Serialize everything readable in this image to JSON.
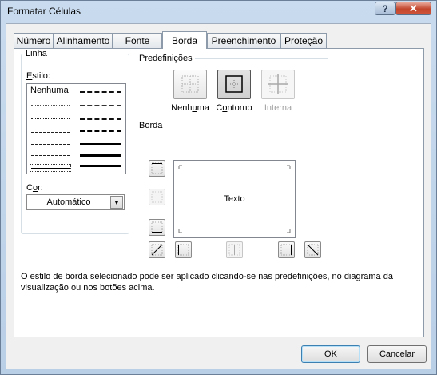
{
  "window": {
    "title": "Formatar Células",
    "help_glyph": "?",
    "close_glyph": "✕"
  },
  "tabs": [
    {
      "label": "Número",
      "active": false
    },
    {
      "label": "Alinhamento",
      "active": false
    },
    {
      "label": "Fonte",
      "active": false
    },
    {
      "label": "Borda",
      "active": true
    },
    {
      "label": "Preenchimento",
      "active": false
    },
    {
      "label": "Proteção",
      "active": false
    }
  ],
  "line_group": {
    "title": "Linha",
    "style_label_accel": "E",
    "style_label_rest": "stilo:",
    "style_none": "Nenhuma",
    "color_label_first": "C",
    "color_label_accel": "o",
    "color_label_rest": "r:",
    "color_value": "Automático"
  },
  "presets": {
    "title": "Predefinições",
    "none": {
      "pre": "Nenh",
      "accel": "u",
      "post": "ma"
    },
    "outline": {
      "pre": "C",
      "accel": "o",
      "post": "ntorno"
    },
    "inside": {
      "label": "Interna",
      "disabled": true
    }
  },
  "border": {
    "title": "Borda",
    "preview_text": "Texto"
  },
  "description": "O estilo de borda selecionado pode ser aplicado clicando-se nas predefinições, no diagrama da visualização ou nos botões acima.",
  "buttons": {
    "ok": "OK",
    "cancel": "Cancelar"
  }
}
